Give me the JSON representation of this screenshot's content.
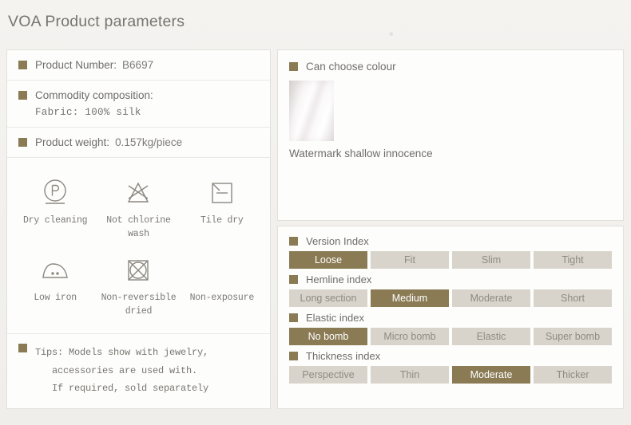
{
  "header": {
    "title": "VOA Product parameters"
  },
  "colors": {
    "accent": "#8a7b55",
    "option_inactive_bg": "#d8d4cb",
    "panel_bg": "#fdfdfc",
    "page_bg": "#f2f1ee"
  },
  "left_panel": {
    "rows": [
      {
        "label": "Product Number:",
        "value": "B6697"
      },
      {
        "label": "Commodity composition:",
        "detail": "Fabric: 100% silk"
      },
      {
        "label": "Product weight:",
        "value": "0.157kg/piece"
      }
    ],
    "care_symbols": [
      {
        "icon": "dry-cleaning-p-circle-icon",
        "label": "Dry cleaning"
      },
      {
        "icon": "no-chlorine-bleach-triangle-icon",
        "label": "Not chlorine wash"
      },
      {
        "icon": "flat-dry-square-icon",
        "label": "Tile dry"
      },
      {
        "icon": "low-iron-two-dots-icon",
        "label": "Low iron"
      },
      {
        "icon": "no-tumble-dry-crossed-square-icon",
        "label": "Non-reversible\ndried"
      },
      {
        "icon": "no-direct-sunlight-icon",
        "label": "Non-exposure"
      }
    ],
    "tips": {
      "line1": "Tips: Models show with jewelry,",
      "line2": "accessories are used with.",
      "line3": "If required, sold separately"
    }
  },
  "colour_panel": {
    "title": "Can choose colour",
    "swatch_caption": "Watermark shallow innocence"
  },
  "index_panel": {
    "groups": [
      {
        "title": "Version Index",
        "options": [
          {
            "label": "Loose",
            "active": true
          },
          {
            "label": "Fit",
            "active": false
          },
          {
            "label": "Slim",
            "active": false
          },
          {
            "label": "Tight",
            "active": false
          }
        ]
      },
      {
        "title": "Hemline index",
        "options": [
          {
            "label": "Long section",
            "active": false
          },
          {
            "label": "Medium",
            "active": true
          },
          {
            "label": "Moderate",
            "active": false
          },
          {
            "label": "Short",
            "active": false
          }
        ]
      },
      {
        "title": "Elastic index",
        "options": [
          {
            "label": "No bomb",
            "active": true
          },
          {
            "label": "Micro bomb",
            "active": false
          },
          {
            "label": "Elastic",
            "active": false
          },
          {
            "label": "Super bomb",
            "active": false
          }
        ]
      },
      {
        "title": "Thickness index",
        "options": [
          {
            "label": "Perspective",
            "active": false
          },
          {
            "label": "Thin",
            "active": false
          },
          {
            "label": "Moderate",
            "active": true
          },
          {
            "label": "Thicker",
            "active": false
          }
        ]
      }
    ]
  }
}
